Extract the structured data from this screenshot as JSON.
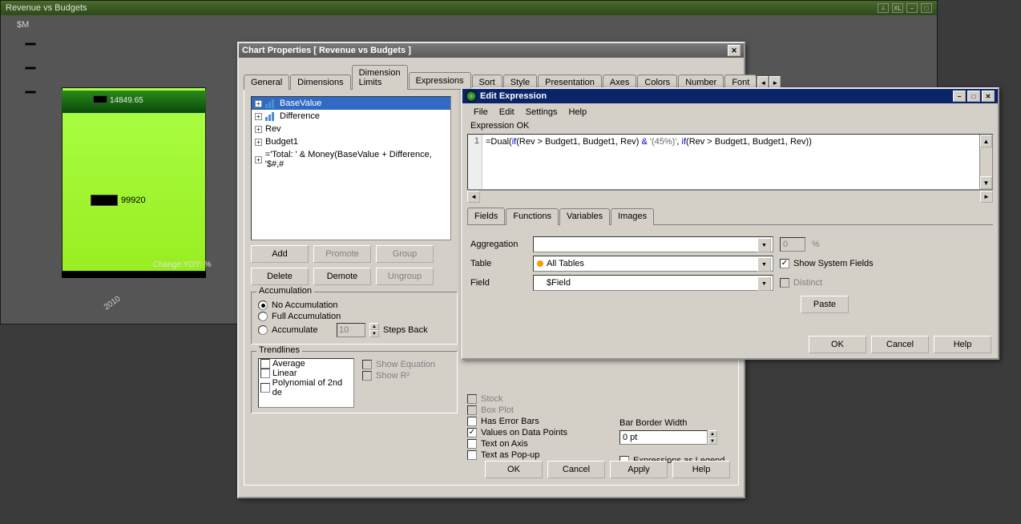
{
  "bg_window": {
    "title": "Revenue vs Budgets",
    "axis_label": "$M",
    "value1": "14849.65",
    "value2": "99920",
    "xaxis_label": "Change YOY: %",
    "year": "2010"
  },
  "props_dialog": {
    "title": "Chart Properties [ Revenue vs Budgets ]",
    "tabs": [
      "General",
      "Dimensions",
      "Dimension Limits",
      "Expressions",
      "Sort",
      "Style",
      "Presentation",
      "Axes",
      "Colors",
      "Number",
      "Font"
    ],
    "active_tab": "Expressions",
    "expressions": [
      {
        "label": "BaseValue",
        "icon": "bar",
        "selected": true
      },
      {
        "label": "Difference",
        "icon": "bar"
      },
      {
        "label": "Rev"
      },
      {
        "label": "Budget1"
      },
      {
        "label": "='Total: ' & Money(BaseValue + Difference, '$#,#"
      }
    ],
    "buttons": {
      "add": "Add",
      "promote": "Promote",
      "group": "Group",
      "delete": "Delete",
      "demote": "Demote",
      "ungroup": "Ungroup"
    },
    "accumulation": {
      "title": "Accumulation",
      "none": "No Accumulation",
      "full": "Full Accumulation",
      "acc": "Accumulate",
      "steps_value": "10",
      "steps_label": "Steps Back"
    },
    "trendlines": {
      "title": "Trendlines",
      "items": [
        "Average",
        "Linear",
        "Polynomial of 2nd de"
      ],
      "show_eq": "Show Equation",
      "show_r2": "Show R²"
    },
    "display_opts": {
      "stock": "Stock",
      "boxplot": "Box Plot",
      "error": "Has Error Bars",
      "vdp": "Values on Data Points",
      "toa": "Text on Axis",
      "tap": "Text as Pop-up"
    },
    "bar_border": {
      "label": "Bar Border Width",
      "value": "0 pt"
    },
    "expr_legend": "Expressions as Legend",
    "dlg_buttons": {
      "ok": "OK",
      "cancel": "Cancel",
      "apply": "Apply",
      "help": "Help"
    }
  },
  "expr_dialog": {
    "title": "Edit Expression",
    "menu": [
      "File",
      "Edit",
      "Settings",
      "Help"
    ],
    "status": "Expression OK",
    "line_no": "1",
    "code_parts": {
      "p1": "=Dual(",
      "p2": "if",
      "p3": "(Rev > Budget1, Budget1, Rev) ",
      "p4": "&",
      "p5": " '(45%)'",
      "p6": ", ",
      "p7": "if",
      "p8": "(Rev > Budget1, Budget1, Rev))"
    },
    "sub_tabs": [
      "Fields",
      "Functions",
      "Variables",
      "Images"
    ],
    "form": {
      "aggregation": "Aggregation",
      "table": "Table",
      "table_val": "All Tables",
      "field": "Field",
      "field_val": "$Field",
      "pct_val": "0",
      "pct_sym": "%",
      "show_sys": "Show System Fields",
      "distinct": "Distinct",
      "paste": "Paste"
    },
    "buttons": {
      "ok": "OK",
      "cancel": "Cancel",
      "help": "Help"
    }
  }
}
